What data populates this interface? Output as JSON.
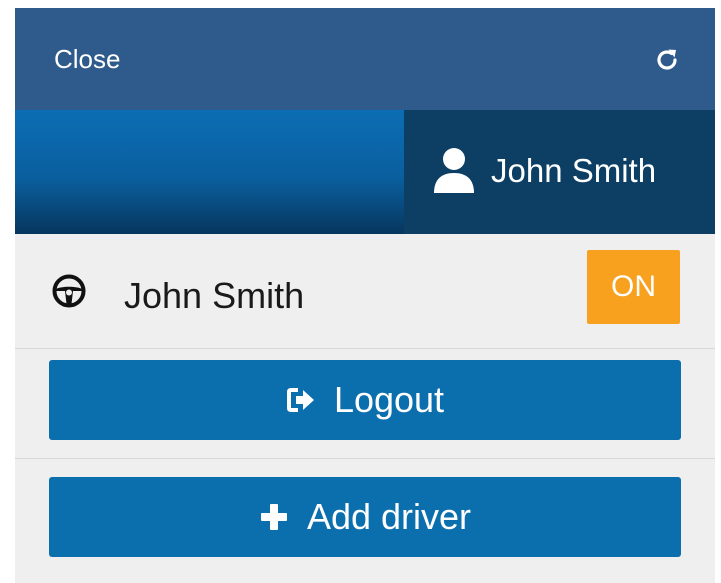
{
  "header": {
    "close_label": "Close",
    "refresh_icon": "refresh-icon"
  },
  "user": {
    "name": "John Smith",
    "icon": "user-icon"
  },
  "driver": {
    "name": "John Smith",
    "icon": "steering-wheel-icon",
    "status": "ON"
  },
  "actions": {
    "logout_label": "Logout",
    "logout_icon": "sign-out-icon",
    "add_driver_label": "Add driver",
    "add_driver_icon": "plus-icon"
  },
  "colors": {
    "header_bg": "#2f5b8c",
    "user_box_bg": "#0d3e64",
    "button_bg": "#0b6fae",
    "badge_bg": "#f7a11e",
    "panel_bg": "#efefef"
  }
}
